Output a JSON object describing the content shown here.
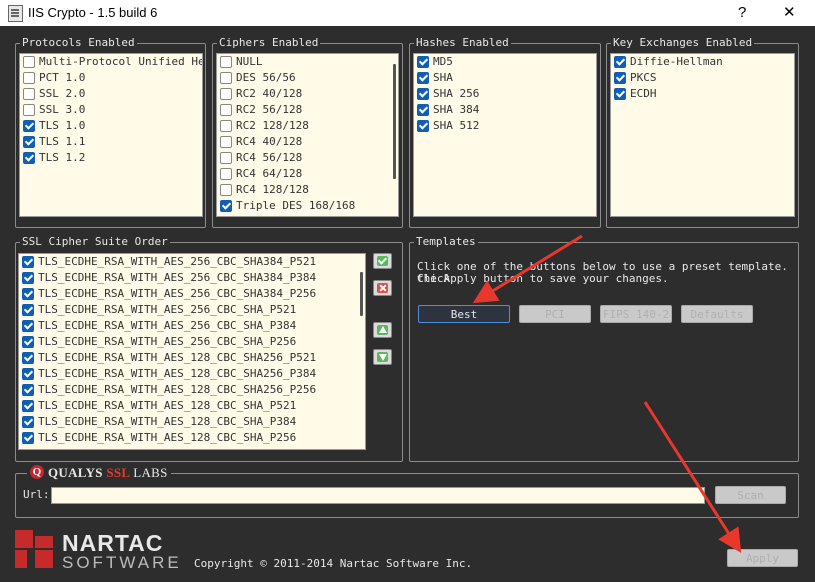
{
  "window": {
    "title": "IIS Crypto - 1.5 build 6",
    "help_label": "?",
    "close_label": "✕"
  },
  "protocols": {
    "legend": "Protocols Enabled",
    "items": [
      {
        "label": "Multi-Protocol Unified Hell",
        "checked": false
      },
      {
        "label": "PCT 1.0",
        "checked": false
      },
      {
        "label": "SSL 2.0",
        "checked": false
      },
      {
        "label": "SSL 3.0",
        "checked": false
      },
      {
        "label": "TLS 1.0",
        "checked": true
      },
      {
        "label": "TLS 1.1",
        "checked": true
      },
      {
        "label": "TLS 1.2",
        "checked": true
      }
    ]
  },
  "ciphers": {
    "legend": "Ciphers Enabled",
    "items": [
      {
        "label": "NULL",
        "checked": false
      },
      {
        "label": "DES 56/56",
        "checked": false
      },
      {
        "label": "RC2 40/128",
        "checked": false
      },
      {
        "label": "RC2 56/128",
        "checked": false
      },
      {
        "label": "RC2 128/128",
        "checked": false
      },
      {
        "label": "RC4 40/128",
        "checked": false
      },
      {
        "label": "RC4 56/128",
        "checked": false
      },
      {
        "label": "RC4 64/128",
        "checked": false
      },
      {
        "label": "RC4 128/128",
        "checked": false
      },
      {
        "label": "Triple DES 168/168",
        "checked": true
      }
    ]
  },
  "hashes": {
    "legend": "Hashes Enabled",
    "items": [
      {
        "label": "MD5",
        "checked": true
      },
      {
        "label": "SHA",
        "checked": true
      },
      {
        "label": "SHA 256",
        "checked": true
      },
      {
        "label": "SHA 384",
        "checked": true
      },
      {
        "label": "SHA 512",
        "checked": true
      }
    ]
  },
  "key_exchanges": {
    "legend": "Key Exchanges Enabled",
    "items": [
      {
        "label": "Diffie-Hellman",
        "checked": true
      },
      {
        "label": "PKCS",
        "checked": true
      },
      {
        "label": "ECDH",
        "checked": true
      }
    ]
  },
  "suites": {
    "legend": "SSL Cipher Suite Order",
    "items": [
      {
        "label": "TLS_ECDHE_RSA_WITH_AES_256_CBC_SHA384_P521",
        "checked": true
      },
      {
        "label": "TLS_ECDHE_RSA_WITH_AES_256_CBC_SHA384_P384",
        "checked": true
      },
      {
        "label": "TLS_ECDHE_RSA_WITH_AES_256_CBC_SHA384_P256",
        "checked": true
      },
      {
        "label": "TLS_ECDHE_RSA_WITH_AES_256_CBC_SHA_P521",
        "checked": true
      },
      {
        "label": "TLS_ECDHE_RSA_WITH_AES_256_CBC_SHA_P384",
        "checked": true
      },
      {
        "label": "TLS_ECDHE_RSA_WITH_AES_256_CBC_SHA_P256",
        "checked": true
      },
      {
        "label": "TLS_ECDHE_RSA_WITH_AES_128_CBC_SHA256_P521",
        "checked": true
      },
      {
        "label": "TLS_ECDHE_RSA_WITH_AES_128_CBC_SHA256_P384",
        "checked": true
      },
      {
        "label": "TLS_ECDHE_RSA_WITH_AES_128_CBC_SHA256_P256",
        "checked": true
      },
      {
        "label": "TLS_ECDHE_RSA_WITH_AES_128_CBC_SHA_P521",
        "checked": true
      },
      {
        "label": "TLS_ECDHE_RSA_WITH_AES_128_CBC_SHA_P384",
        "checked": true
      },
      {
        "label": "TLS_ECDHE_RSA_WITH_AES_128_CBC_SHA_P256",
        "checked": true
      }
    ],
    "side_buttons": [
      {
        "name": "check-all-button",
        "icon": "check-icon",
        "color": "#5cb85c"
      },
      {
        "name": "uncheck-all-button",
        "icon": "x-icon",
        "color": "#d9534f"
      },
      {
        "name": "move-up-button",
        "icon": "arrow-up-icon",
        "color": "#5cb85c"
      },
      {
        "name": "move-down-button",
        "icon": "arrow-down-icon",
        "color": "#5cb85c"
      }
    ]
  },
  "templates": {
    "legend": "Templates",
    "description_line1": "Click one of the buttons below to use a preset template. Click",
    "description_line2": "the Apply button to save your changes.",
    "buttons": [
      {
        "label": "Best",
        "active": true
      },
      {
        "label": "PCI",
        "active": false
      },
      {
        "label": "FIPS 140-2",
        "active": false
      },
      {
        "label": "Defaults",
        "active": false
      }
    ]
  },
  "qualys": {
    "brand_qualys": "QUALYS",
    "brand_ssl": "SSL",
    "brand_labs": "LABS",
    "icon": "qualys-q-icon",
    "url_label": "Url:",
    "url_value": "",
    "scan_button": "Scan"
  },
  "footer": {
    "logo_line1": "NARTAC",
    "logo_line2": "SOFTWARE",
    "copyright": "Copyright © 2011-2014 Nartac Software Inc.",
    "apply_button": "Apply"
  },
  "colors": {
    "background": "#2d2d2d",
    "list_background": "#fffbe8",
    "checkbox_checked": "#0f5fb5",
    "annotation_arrow": "#e8382d",
    "brand_red": "#c62a2a"
  }
}
